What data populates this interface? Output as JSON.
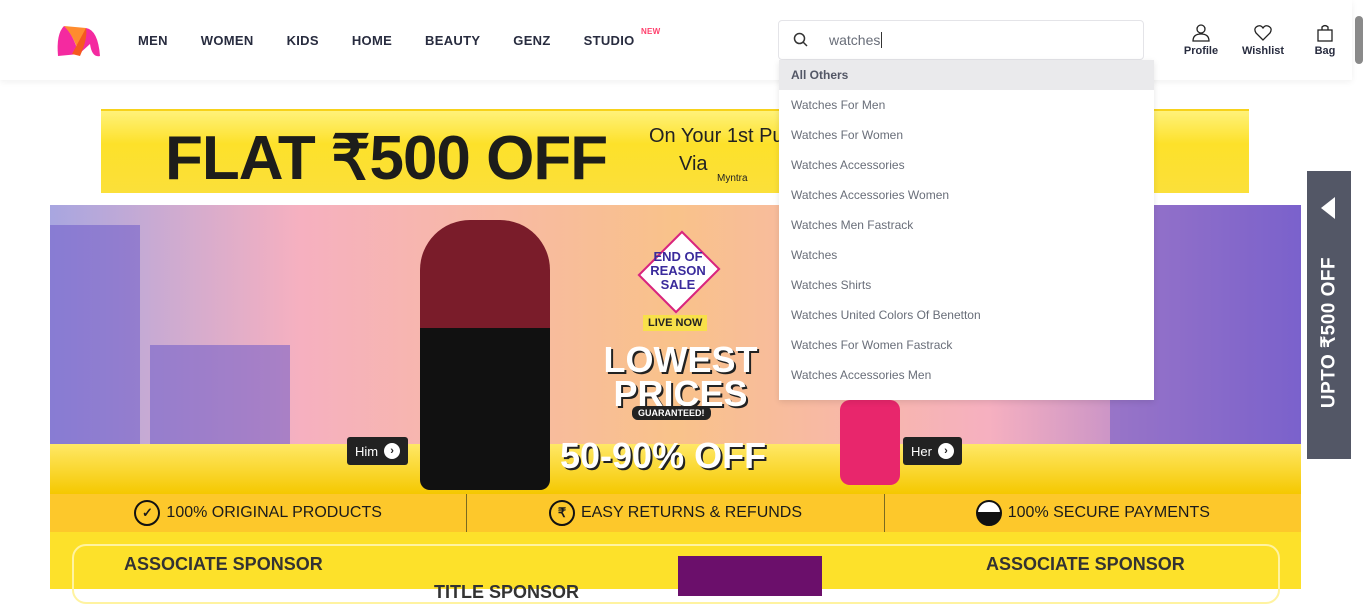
{
  "header": {
    "nav": [
      "MEN",
      "WOMEN",
      "KIDS",
      "HOME",
      "BEAUTY",
      "GENZ",
      "STUDIO"
    ],
    "studio_badge": "NEW",
    "search": {
      "value": "watches"
    },
    "actions": [
      {
        "label": "Profile",
        "icon": "profile-icon"
      },
      {
        "label": "Wishlist",
        "icon": "heart-icon"
      },
      {
        "label": "Bag",
        "icon": "bag-icon"
      }
    ]
  },
  "dropdown": {
    "header": "All Others",
    "items": [
      "Watches For Men",
      "Watches For Women",
      "Watches Accessories",
      "Watches Accessories Women",
      "Watches Men Fastrack",
      "Watches",
      "Watches Shirts",
      "Watches United Colors Of Benetton",
      "Watches For Women Fastrack",
      "Watches Accessories Men"
    ]
  },
  "offer_banner": {
    "headline": "FLAT ₹500 OFF",
    "line1": "On Your 1st Pur",
    "line2": "Via",
    "brand": "Myntra"
  },
  "hero": {
    "tag": "END OF REASON SALE",
    "live": "LIVE NOW",
    "lowest": "LOWEST PRICES",
    "guaranteed": "GUARANTEED!",
    "discount": "50-90% OFF",
    "him": "Him",
    "her": "Her"
  },
  "trust": [
    "100% ORIGINAL PRODUCTS",
    "EASY RETURNS & REFUNDS",
    "100% SECURE PAYMENTS"
  ],
  "sponsors": {
    "left": "ASSOCIATE SPONSOR",
    "middle": "TITLE SPONSOR",
    "right": "ASSOCIATE SPONSOR"
  },
  "side_tab": "UPTO ₹500 OFF"
}
